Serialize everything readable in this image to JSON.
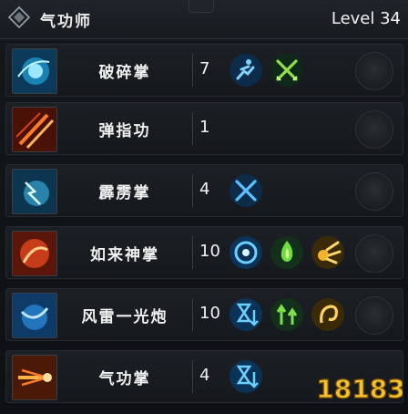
{
  "header": {
    "title": "气功师",
    "level": "Level 34"
  },
  "skills": [
    {
      "name": "破碎掌",
      "level": "7",
      "icon": "blue-palm-burst-icon",
      "badges": [
        "sprint-icon",
        "crossed-swords-green-icon"
      ]
    },
    {
      "name": "弹指功",
      "level": "1",
      "icon": "fire-slash-icon",
      "badges": []
    },
    {
      "name": "霹雳掌",
      "level": "4",
      "icon": "lightning-palm-icon",
      "badges": [
        "crossed-swords-blue-icon"
      ]
    },
    {
      "name": "如来神掌",
      "level": "10",
      "icon": "fire-palm-icon",
      "badges": [
        "frost-orb-icon",
        "green-flame-icon",
        "gold-impact-icon"
      ]
    },
    {
      "name": "风雷一光炮",
      "level": "10",
      "icon": "wind-thunder-blast-icon",
      "badges": [
        "hourglass-down-icon",
        "arrows-up-icon",
        "gold-spiral-icon"
      ]
    },
    {
      "name": "气功掌",
      "level": "4",
      "icon": "flame-palm-icon",
      "badges": [
        "hourglass-down-icon"
      ]
    }
  ],
  "watermark": {
    "text": "18183"
  }
}
